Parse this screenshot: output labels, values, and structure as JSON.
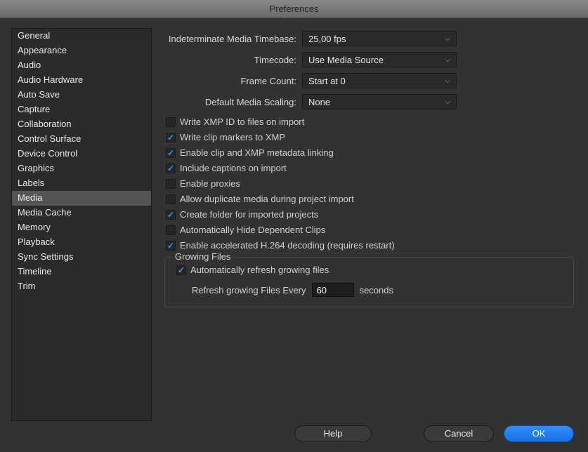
{
  "window": {
    "title": "Preferences"
  },
  "sidebar": {
    "items": [
      "General",
      "Appearance",
      "Audio",
      "Audio Hardware",
      "Auto Save",
      "Capture",
      "Collaboration",
      "Control Surface",
      "Device Control",
      "Graphics",
      "Labels",
      "Media",
      "Media Cache",
      "Memory",
      "Playback",
      "Sync Settings",
      "Timeline",
      "Trim"
    ],
    "selected": "Media"
  },
  "form": {
    "timebase": {
      "label": "Indeterminate Media Timebase:",
      "value": "25,00 fps"
    },
    "timecode": {
      "label": "Timecode:",
      "value": "Use Media Source"
    },
    "framecount": {
      "label": "Frame Count:",
      "value": "Start at 0"
    },
    "scaling": {
      "label": "Default Media Scaling:",
      "value": "None"
    }
  },
  "checks": [
    {
      "label": "Write XMP ID to files on import",
      "checked": false
    },
    {
      "label": "Write clip markers to XMP",
      "checked": true
    },
    {
      "label": "Enable clip and XMP metadata linking",
      "checked": true
    },
    {
      "label": "Include captions on import",
      "checked": true
    },
    {
      "label": "Enable proxies",
      "checked": false
    },
    {
      "label": "Allow duplicate media during project import",
      "checked": false
    },
    {
      "label": "Create folder for imported projects",
      "checked": true
    },
    {
      "label": "Automatically Hide Dependent Clips",
      "checked": false
    },
    {
      "label": "Enable accelerated H.264 decoding (requires restart)",
      "checked": true
    }
  ],
  "group": {
    "title": "Growing Files",
    "autoRefresh": {
      "label": "Automatically refresh growing files",
      "checked": true
    },
    "interval": {
      "prefix": "Refresh growing Files Every",
      "value": "60",
      "suffix": "seconds"
    }
  },
  "buttons": {
    "help": "Help",
    "cancel": "Cancel",
    "ok": "OK"
  }
}
